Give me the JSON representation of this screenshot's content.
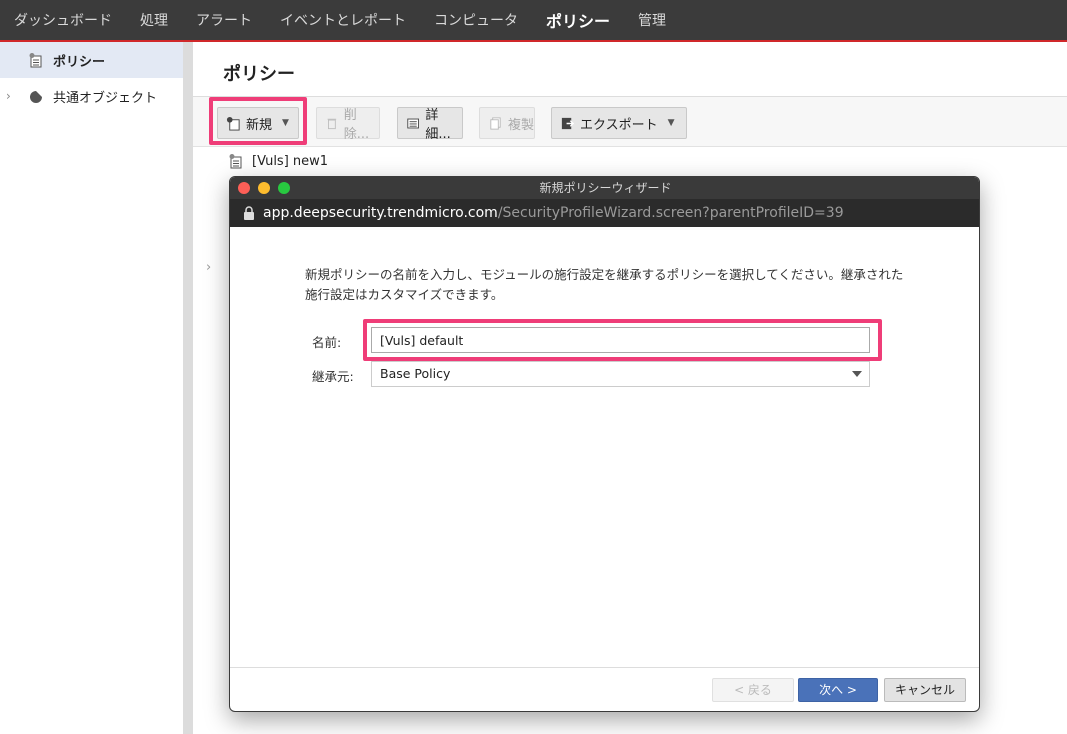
{
  "topnav": {
    "items": [
      "ダッシュボード",
      "処理",
      "アラート",
      "イベントとレポート",
      "コンピュータ",
      "ポリシー",
      "管理"
    ],
    "active_index": 5
  },
  "sidebar": {
    "items": [
      {
        "label": "ポリシー",
        "icon": "policy-icon",
        "selected": true
      },
      {
        "label": "共通オブジェクト",
        "icon": "common-objects-icon",
        "selected": false
      }
    ]
  },
  "main": {
    "title": "ポリシー",
    "toolbar": {
      "new_label": "新規",
      "delete_label": "削除...",
      "details_label": "詳細...",
      "duplicate_label": "複製",
      "export_label": "エクスポート"
    },
    "tree_item": "[Vuls] new1"
  },
  "dialog": {
    "title": "新規ポリシーウィザード",
    "url_host": "app.deepsecurity.trendmicro.com",
    "url_path": "/SecurityProfileWizard.screen?parentProfileID=39",
    "description": "新規ポリシーの名前を入力し、モジュールの施行設定を継承するポリシーを選択してください。継承された施行設定はカスタマイズできます。",
    "name_label": "名前:",
    "name_value": "[Vuls] default",
    "inherit_label": "継承元:",
    "inherit_value": "Base Policy",
    "back_label": "< 戻る",
    "next_label": "次へ >",
    "cancel_label": "キャンセル"
  },
  "colors": {
    "highlight": "#ef3d78",
    "accent_red": "#d0282a",
    "primary_button": "#4a72b9"
  }
}
